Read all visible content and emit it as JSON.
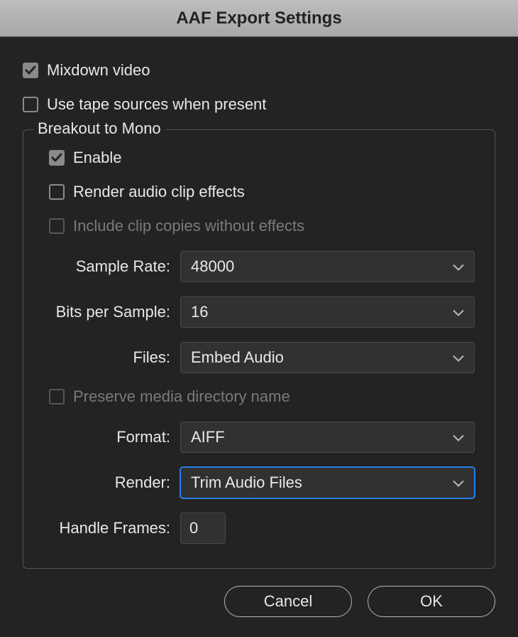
{
  "title": "AAF Export Settings",
  "checkboxes": {
    "mixdown_video": {
      "label": "Mixdown video",
      "checked": true,
      "disabled": false
    },
    "use_tape_sources": {
      "label": "Use tape sources when present",
      "checked": false,
      "disabled": false
    }
  },
  "breakout": {
    "legend": "Breakout to Mono",
    "enable": {
      "label": "Enable",
      "checked": true,
      "disabled": false
    },
    "render_effects": {
      "label": "Render audio clip effects",
      "checked": false,
      "disabled": false
    },
    "include_copies": {
      "label": "Include clip copies without effects",
      "checked": false,
      "disabled": true
    },
    "sample_rate": {
      "label": "Sample Rate:",
      "value": "48000"
    },
    "bits_per_sample": {
      "label": "Bits per Sample:",
      "value": "16"
    },
    "files": {
      "label": "Files:",
      "value": "Embed Audio"
    },
    "preserve_dir": {
      "label": "Preserve media directory name",
      "checked": false,
      "disabled": true
    },
    "format": {
      "label": "Format:",
      "value": "AIFF"
    },
    "render": {
      "label": "Render:",
      "value": "Trim Audio Files"
    },
    "handle_frames": {
      "label": "Handle Frames:",
      "value": "0"
    }
  },
  "buttons": {
    "cancel": "Cancel",
    "ok": "OK"
  }
}
